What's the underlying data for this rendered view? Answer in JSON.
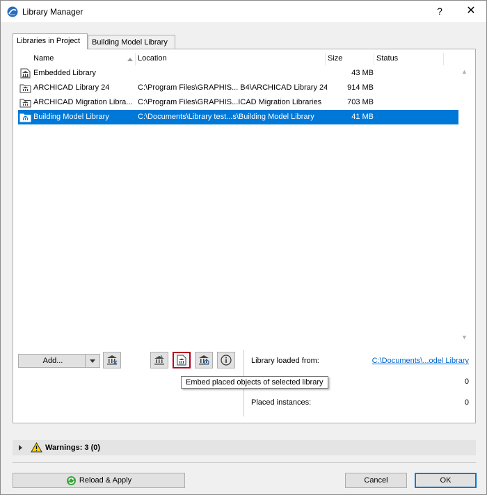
{
  "window": {
    "title": "Library Manager",
    "help_label": "?",
    "close_label": "✕"
  },
  "tabs": [
    {
      "label": "Libraries in Project",
      "active": true
    },
    {
      "label": "Building Model Library",
      "active": false
    }
  ],
  "table": {
    "columns": [
      "Name",
      "Location",
      "Size",
      "Status"
    ],
    "rows": [
      {
        "name": "Embedded Library",
        "location": "",
        "size": "43 MB",
        "status": "",
        "selected": false
      },
      {
        "name": "ARCHICAD Library 24",
        "location": "C:\\Program Files\\GRAPHIS... B4\\ARCHICAD Library 24",
        "size": "914 MB",
        "status": "",
        "selected": false
      },
      {
        "name": "ARCHICAD Migration Libra...",
        "location": "C:\\Program Files\\GRAPHIS...ICAD Migration Libraries",
        "size": "703 MB",
        "status": "",
        "selected": false
      },
      {
        "name": "Building Model Library",
        "location": "C:\\Documents\\Library test...s\\Building Model Library",
        "size": "41 MB",
        "status": "",
        "selected": true
      }
    ]
  },
  "toolbar": {
    "add_label": "Add...",
    "tooltip": "Embed placed objects of selected library"
  },
  "info": {
    "loaded_from_label": "Library loaded from:",
    "loaded_from_value": "C:\\Documents\\...odel Library",
    "second_value": "0",
    "placed_instances_label": "Placed instances:",
    "placed_instances_value": "0"
  },
  "warnings": {
    "label": "Warnings: 3 (0)"
  },
  "footer": {
    "reload_label": "Reload & Apply",
    "cancel_label": "Cancel",
    "ok_label": "OK"
  },
  "colors": {
    "selection": "#0078d7",
    "pressed_border": "#b4001e",
    "link": "#0066cc"
  }
}
